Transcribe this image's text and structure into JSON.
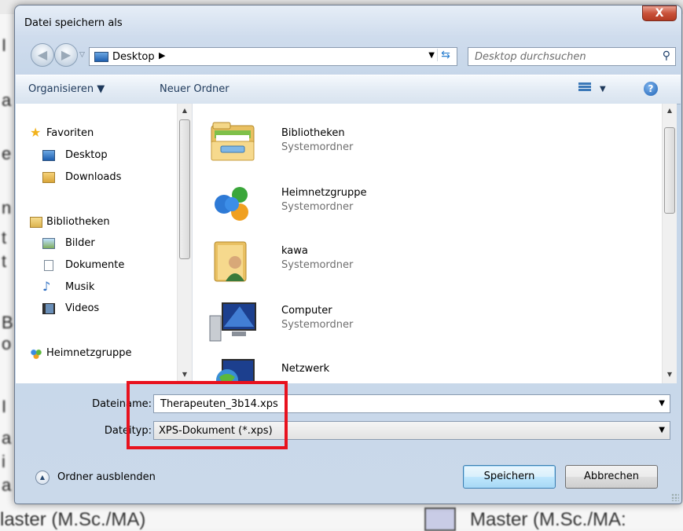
{
  "background_doc": {
    "left_fragments": [
      "I",
      "a",
      "e",
      "n",
      "t",
      "t",
      "B",
      "o",
      "I",
      "a",
      "i",
      "a"
    ],
    "bottom_text_left": "laster (M.Sc./MA)",
    "bottom_text_right": "Master (M.Sc./MA:"
  },
  "dialog": {
    "title": "Datei speichern als",
    "close_label": "X"
  },
  "address": {
    "location": "Desktop",
    "separator": "▶",
    "search_placeholder": "Desktop durchsuchen"
  },
  "toolbar": {
    "organize_label": "Organisieren ▼",
    "new_folder_label": "Neuer Ordner",
    "views_arrow": "▼",
    "help_label": "?"
  },
  "nav": {
    "favorites_label": "Favoriten",
    "favorites": [
      "Desktop",
      "Downloads"
    ],
    "libraries_label": "Bibliotheken",
    "libraries": [
      "Bilder",
      "Dokumente",
      "Musik",
      "Videos"
    ],
    "homegroup_label": "Heimnetzgruppe"
  },
  "files": [
    {
      "name": "Bibliotheken",
      "type": "Systemordner",
      "icon": "libraries-icon"
    },
    {
      "name": "Heimnetzgruppe",
      "type": "Systemordner",
      "icon": "homegroup-icon"
    },
    {
      "name": "kawa",
      "type": "Systemordner",
      "icon": "user-folder-icon"
    },
    {
      "name": "Computer",
      "type": "Systemordner",
      "icon": "computer-icon"
    },
    {
      "name": "Netzwerk",
      "type": "",
      "icon": "network-icon"
    }
  ],
  "form": {
    "filename_label": "Dateiname:",
    "filename_value": "Therapeuten_3b14.xps",
    "filetype_label": "Dateityp:",
    "filetype_value": "XPS-Dokument (*.xps)"
  },
  "footer": {
    "hide_folders_label": "Ordner ausblenden",
    "save_label": "Speichern",
    "cancel_label": "Abbrechen"
  },
  "colors": {
    "highlight_box": "#e8121e",
    "close_button": "#c9523a"
  }
}
